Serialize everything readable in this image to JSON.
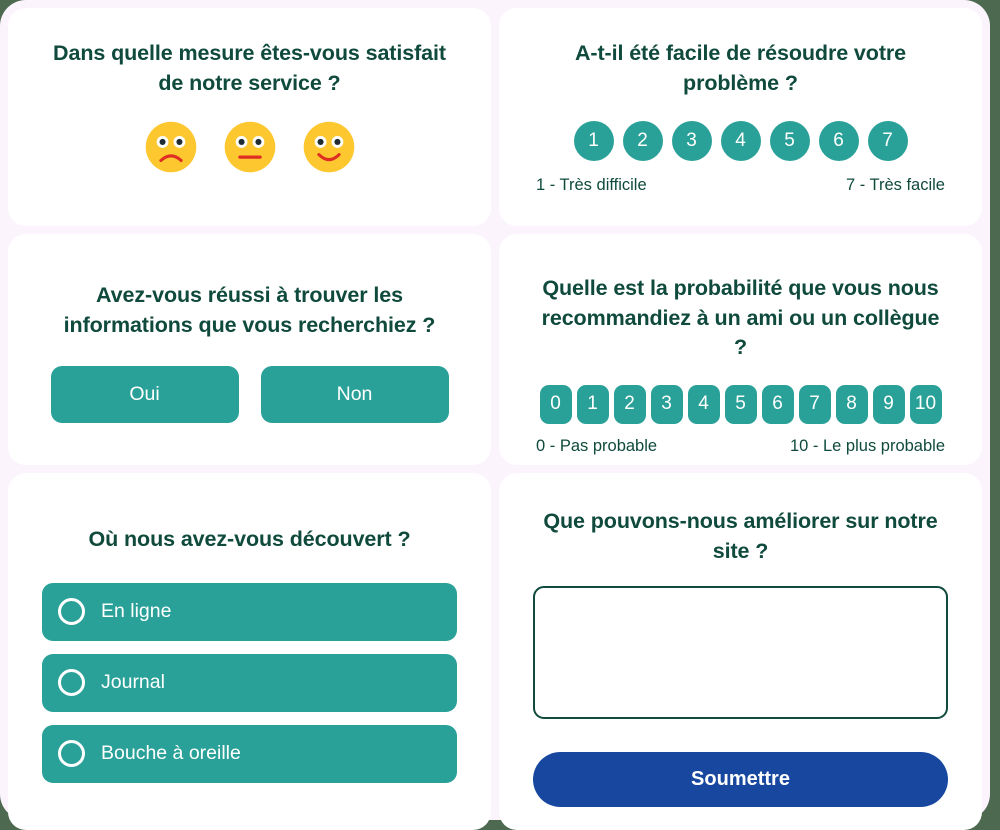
{
  "theme": {
    "page_background": "#4d6a50",
    "panel_background": "#fbf4fd",
    "card_background": "#ffffff",
    "accent_teal": "#2aa198",
    "accent_blue": "#17479e",
    "text_dark_green": "#0f4a3c",
    "emoji_yellow": "#fdc72f",
    "emoji_mouth_red": "#e02d24",
    "emoji_pupil": "#1f2c33"
  },
  "satisfaction": {
    "question": "Dans quelle mesure êtes-vous satisfait de notre service ?",
    "options": [
      {
        "name": "sad",
        "icon": "frowning-face-icon"
      },
      {
        "name": "neutral",
        "icon": "neutral-face-icon"
      },
      {
        "name": "happy",
        "icon": "smiling-face-icon"
      }
    ]
  },
  "effort": {
    "question": "A-t-il été facile de résoudre votre problème ?",
    "scale": [
      "1",
      "2",
      "3",
      "4",
      "5",
      "6",
      "7"
    ],
    "legend_low": "1 - Très difficile",
    "legend_high": "7 - Très facile"
  },
  "found_info": {
    "question": "Avez-vous réussi à trouver les informations que vous recherchiez ?",
    "yes_label": "Oui",
    "no_label": "Non"
  },
  "nps": {
    "question": "Quelle est la probabilité que vous nous recommandiez à un ami ou un collègue ?",
    "scale": [
      "0",
      "1",
      "2",
      "3",
      "4",
      "5",
      "6",
      "7",
      "8",
      "9",
      "10"
    ],
    "legend_low": "0 - Pas probable",
    "legend_high": "10 - Le plus probable"
  },
  "source": {
    "question": "Où nous avez-vous découvert ?",
    "options": [
      {
        "label": "En ligne"
      },
      {
        "label": "Journal"
      },
      {
        "label": "Bouche à oreille"
      }
    ]
  },
  "improve": {
    "question": "Que pouvons-nous améliorer sur notre site ?",
    "textarea_value": "",
    "textarea_placeholder": "",
    "submit_label": "Soumettre"
  }
}
